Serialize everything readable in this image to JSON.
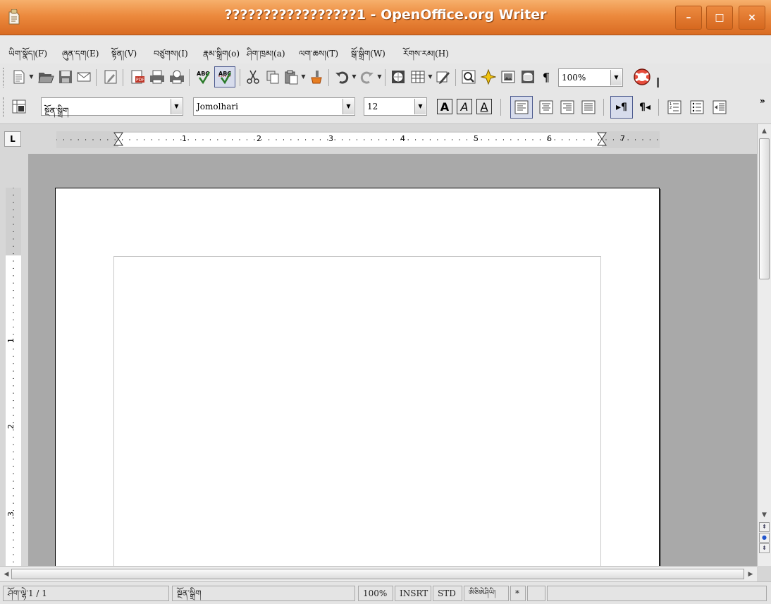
{
  "window": {
    "title": "?????????????????1 - OpenOffice.org Writer",
    "minimize_glyph": "–",
    "maximize_glyph": "□",
    "close_glyph": "×"
  },
  "menu": [
    {
      "label": "ཡིག་སྣོད།(F)"
    },
    {
      "label": "ཞུན་དག(E)"
    },
    {
      "label": "སྟོན།(V)"
    },
    {
      "label": "བཙུགས།(I)"
    },
    {
      "label": "རྣམ་སྒྲིག(o)"
    },
    {
      "label": "ཤིག་ཁྲམ།(a)"
    },
    {
      "label": "ལག་ཆས།(T)"
    },
    {
      "label": "སྒོ་སྒྲིག(W)"
    },
    {
      "label": "རོགས་རམ།(H)"
    }
  ],
  "toolbar1": {
    "icons": [
      "new-document-icon",
      "open-folder-icon",
      "save-icon",
      "email-icon",
      "edit-file-icon",
      "export-pdf-icon",
      "print-icon",
      "page-preview-icon",
      "spellcheck-icon",
      "autospellcheck-icon",
      "cut-icon",
      "copy-icon",
      "paste-icon",
      "format-paintbrush-icon",
      "undo-icon",
      "redo-icon",
      "hyperlink-icon",
      "table-icon",
      "draw-functions-icon",
      "find-replace-icon",
      "navigator-icon",
      "gallery-icon",
      "data-sources-icon",
      "formatting-marks-icon",
      "help-icon"
    ],
    "zoom_value": "100%",
    "pilcrow": "¶",
    "pdf_label": "PDF",
    "abc_label": "ABC"
  },
  "toolbar2": {
    "paragraph_style": "སྔོན་སྒྲིག",
    "font_name": "Jomolhari",
    "font_size": "12",
    "bold_glyph": "A",
    "italic_glyph": "A",
    "underline_glyph": "A",
    "ltr_glyph": "▸¶",
    "rtl_glyph": "¶◂",
    "overflow_glyph": "»"
  },
  "ruler": {
    "tab_stop_glyph": "L",
    "h_numbers": [
      "1",
      "2",
      "3",
      "4",
      "5",
      "6",
      "7"
    ],
    "v_numbers": [
      "1",
      "2",
      "3"
    ]
  },
  "statusbar": {
    "page": "ཤོག་ལྷེ་1 / 1",
    "page_style": "སྔོན་སྒྲིག",
    "zoom": "100%",
    "insert_mode": "INSRT",
    "selection_mode": "STD",
    "language": "ཨིཅིཨེཤིཡི།",
    "modified": "*"
  },
  "colors": {
    "titlebar": "#e8833a",
    "page": "#ffffff",
    "workspace": "#a9a9a9"
  }
}
